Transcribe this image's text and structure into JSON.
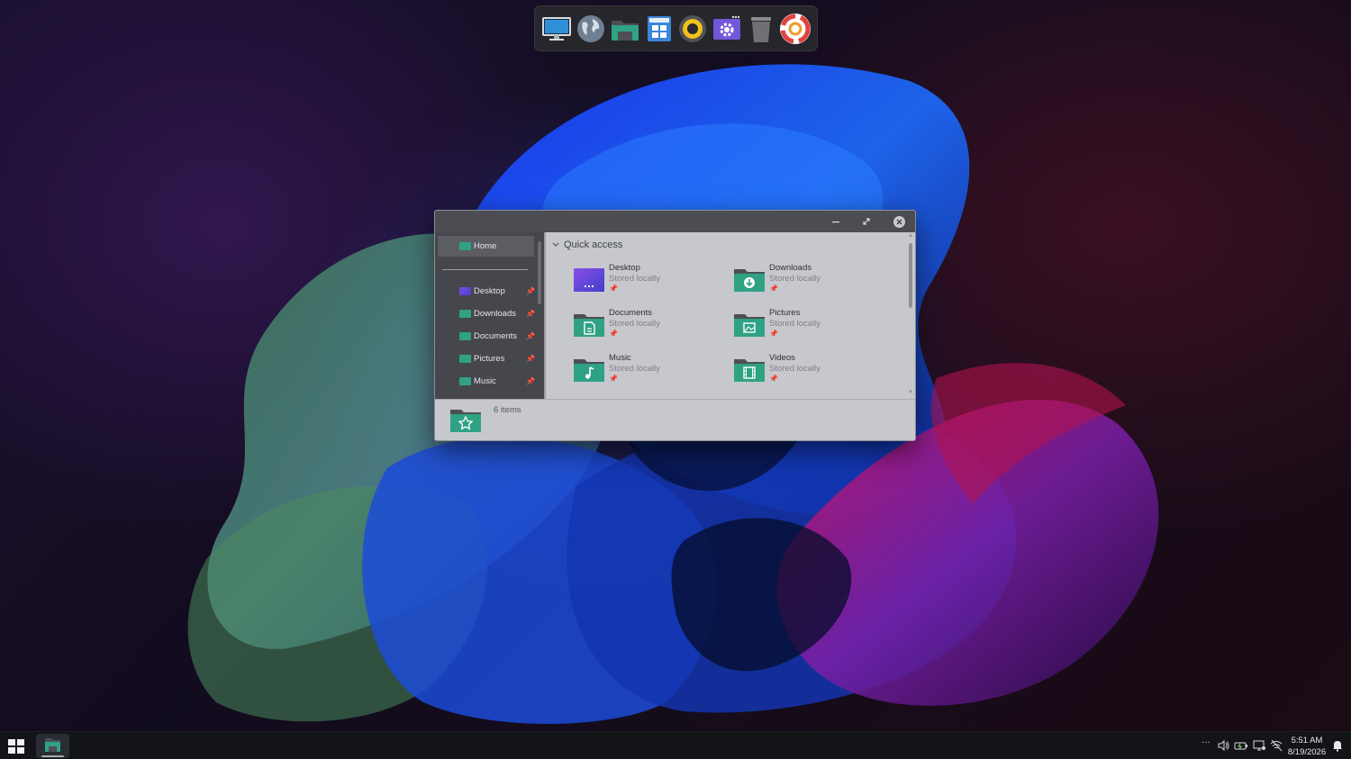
{
  "dock": {
    "items": [
      {
        "name": "desktop"
      },
      {
        "name": "browser"
      },
      {
        "name": "file-explorer"
      },
      {
        "name": "microsoft-store"
      },
      {
        "name": "media-player"
      },
      {
        "name": "settings"
      },
      {
        "name": "recycle-bin"
      },
      {
        "name": "app-launcher"
      }
    ]
  },
  "window": {
    "controls": {
      "minimize": "–",
      "maximize": "⤢",
      "close": "✕"
    },
    "sidebar": {
      "home": "Home",
      "items": [
        {
          "label": "Desktop",
          "pin": "📌"
        },
        {
          "label": "Downloads",
          "pin": "📌"
        },
        {
          "label": "Documents",
          "pin": "📌"
        },
        {
          "label": "Pictures",
          "pin": "📌"
        },
        {
          "label": "Music",
          "pin": "📌"
        }
      ]
    },
    "quick_access": {
      "title": "Quick access",
      "tiles": [
        {
          "name": "Desktop",
          "sub": "Stored locally",
          "icon": "desktop-folder-icon"
        },
        {
          "name": "Downloads",
          "sub": "Stored locally",
          "icon": "downloads-folder-icon"
        },
        {
          "name": "Documents",
          "sub": "Stored locally",
          "icon": "documents-folder-icon"
        },
        {
          "name": "Pictures",
          "sub": "Stored locally",
          "icon": "pictures-folder-icon"
        },
        {
          "name": "Music",
          "sub": "Stored locally",
          "icon": "music-folder-icon"
        },
        {
          "name": "Videos",
          "sub": "Stored locally",
          "icon": "videos-folder-icon"
        }
      ],
      "pin": "📌"
    },
    "status": {
      "text": "6 items"
    }
  },
  "taskbar": {
    "overflow": "···",
    "clock": {
      "time": "5:51 AM",
      "date": "8/19/2026"
    }
  },
  "colors": {
    "folder_teal": "#2fa283",
    "folder_tab": "#4d4f55",
    "desktop_purple": "#6f45e0"
  }
}
